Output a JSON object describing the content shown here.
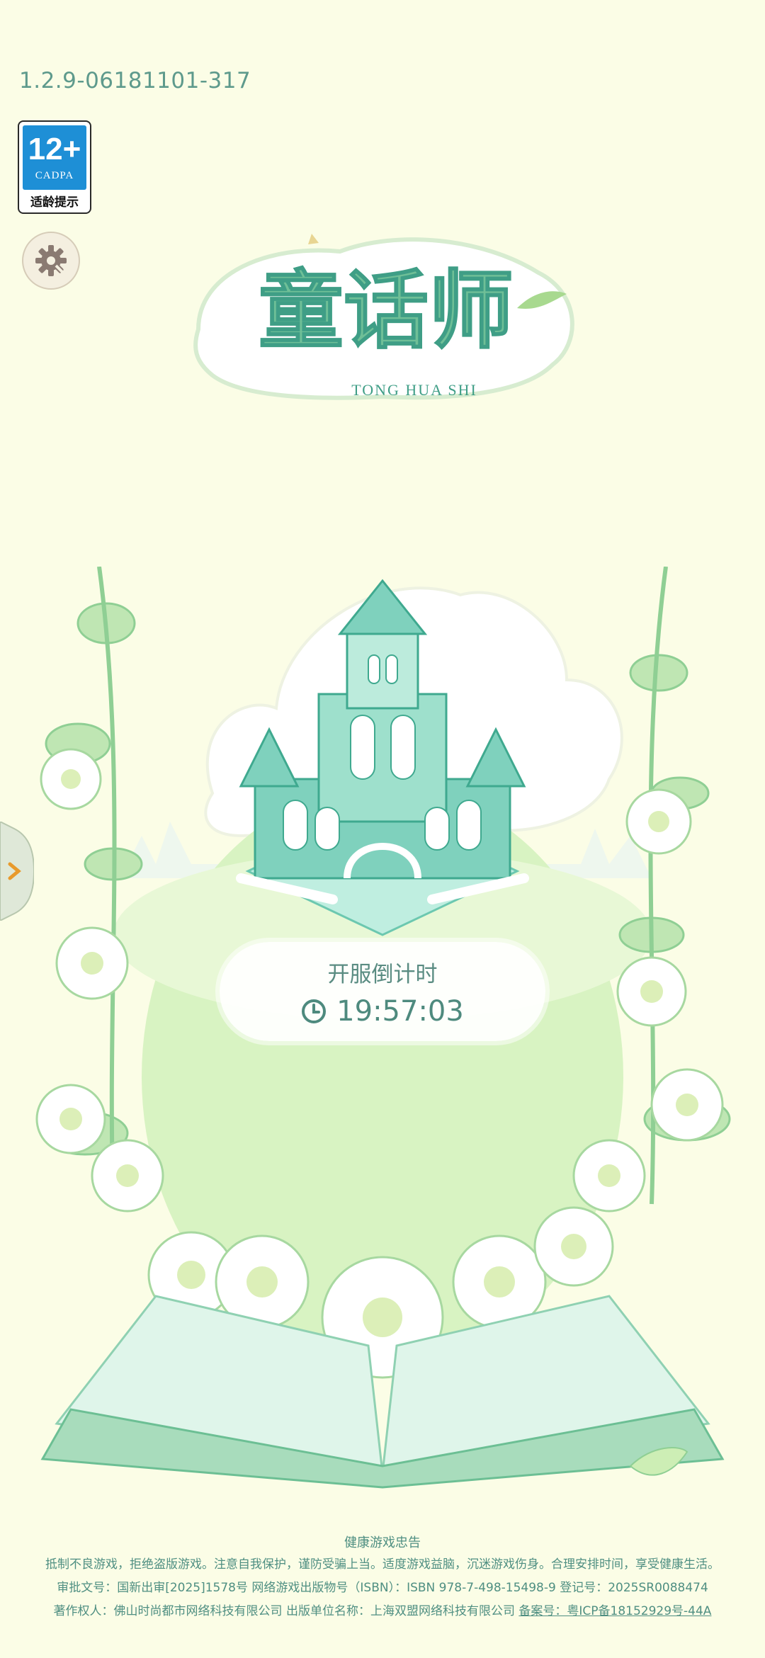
{
  "version": "1.2.9-06181101-317",
  "age_rating": {
    "age": "12+",
    "org": "CADPA",
    "label": "适龄提示"
  },
  "logo": {
    "title": "童话师",
    "subtitle": "TONG HUA SHI"
  },
  "countdown": {
    "label": "开服倒计时",
    "time": "19:57:03"
  },
  "footer": {
    "title": "健康游戏忠告",
    "advice": "抵制不良游戏，拒绝盗版游戏。注意自我保护，谨防受骗上当。适度游戏益脑，沉迷游戏伤身。合理安排时间，享受健康生活。",
    "approval": "审批文号：国新出审[2025]1578号  网络游戏出版物号（ISBN）：ISBN 978-7-498-15498-9  登记号：2025SR0088474",
    "copyright": "著作权人：佛山时尚都市网络科技有限公司  出版单位名称：上海双盟网络科技有限公司",
    "icp": "备案号：粤ICP备18152929号-44A"
  },
  "colors": {
    "background": "#fbfde6",
    "accent": "#4e8a7e",
    "age_blue": "#1e8fd6"
  },
  "icons": [
    "gear-icon",
    "clock-icon",
    "chevron-right-icon"
  ]
}
